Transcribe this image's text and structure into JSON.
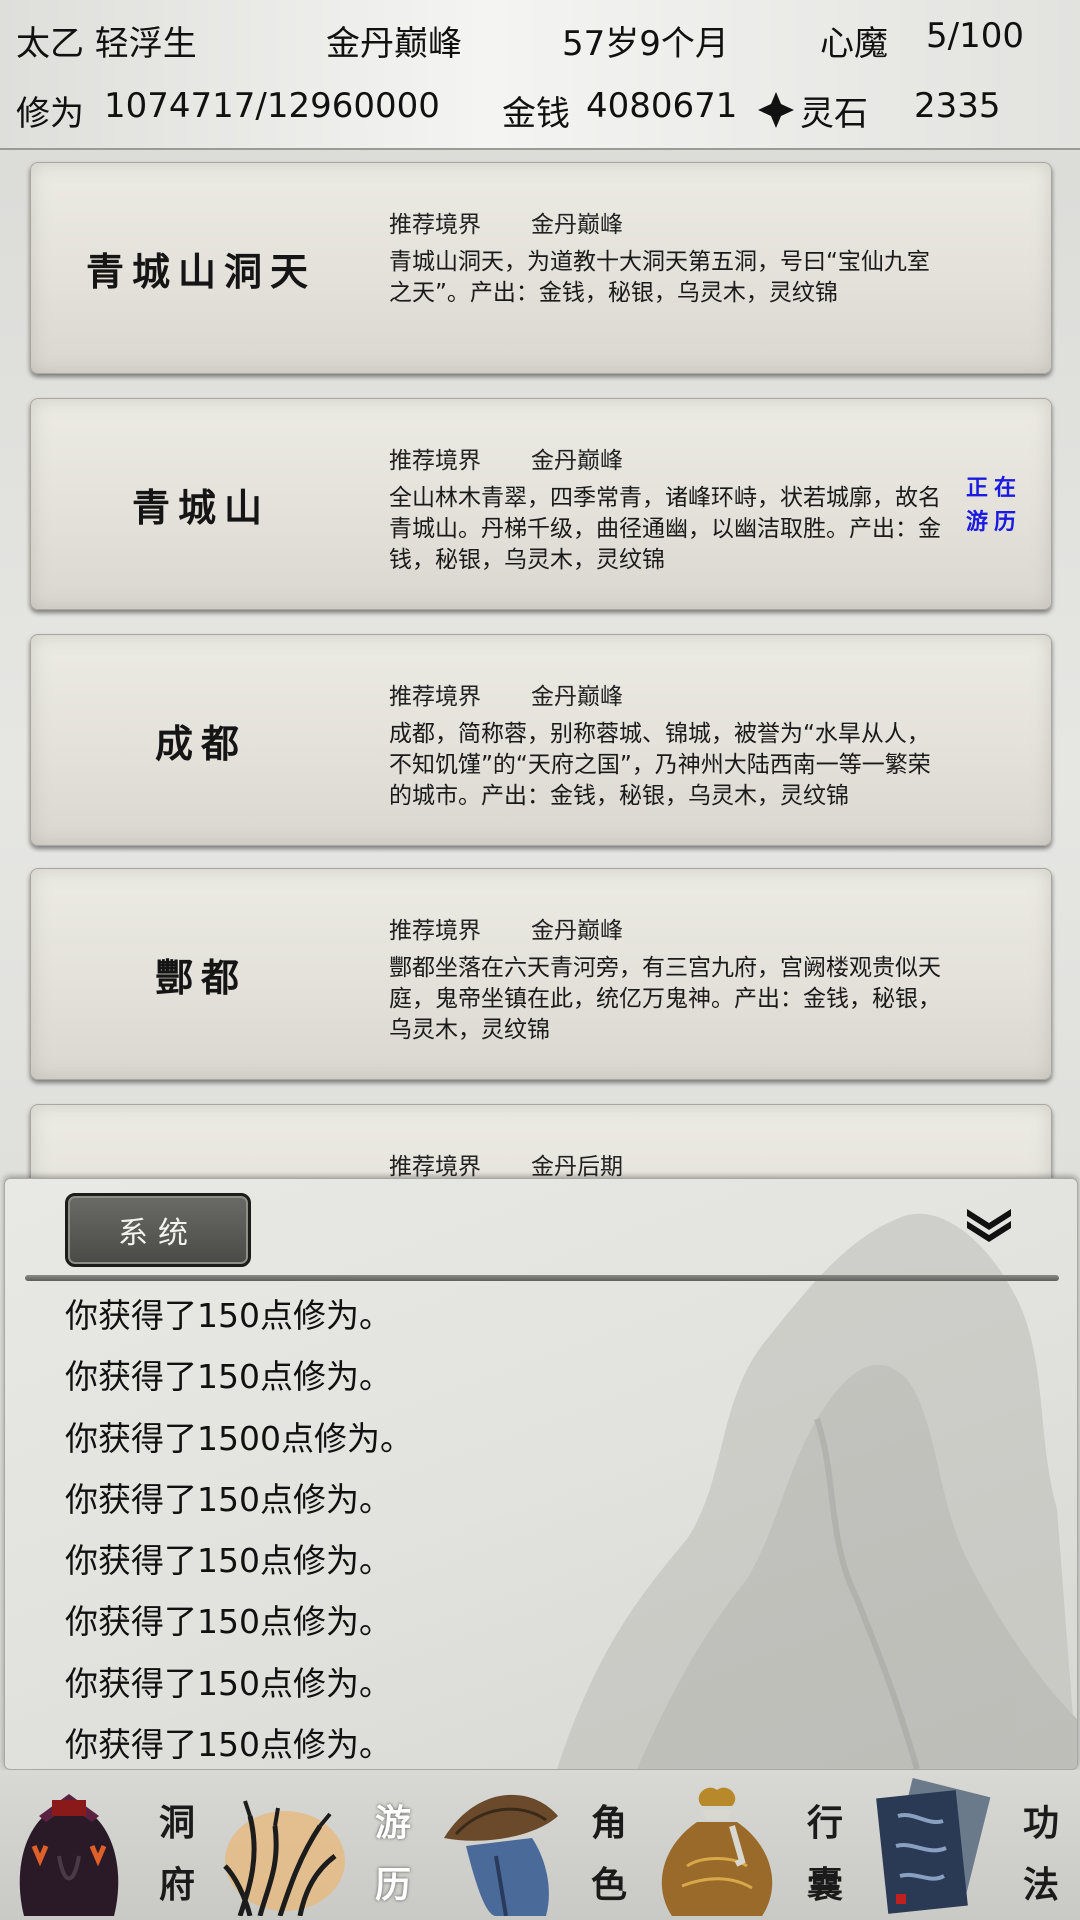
{
  "header": {
    "name": "太乙 轻浮生",
    "realm": "金丹巅峰",
    "age": "57岁9个月",
    "heart_demon_label": "心魔",
    "heart_demon_value": "5/100",
    "cultivation_label": "修为",
    "cultivation_value": "1074717/12960000",
    "money_label": "金钱",
    "money_value": "4080671",
    "spirit_stone_label": "灵石",
    "spirit_stone_value": "2335",
    "spirit_stone_icon": "spirit-stone-icon"
  },
  "locations": [
    {
      "name": "青城山洞天",
      "rec_label": "推荐境界",
      "rec_value": "金丹巅峰",
      "desc": "青城山洞天，为道教十大洞天第五洞，号曰“宝仙九室之天”。产出：金钱，秘银，乌灵木，灵纹锦"
    },
    {
      "name": "青城山",
      "rec_label": "推荐境界",
      "rec_value": "金丹巅峰",
      "desc": "全山林木青翠，四季常青，诸峰环峙，状若城廓，故名青城山。丹梯千级，曲径通幽，以幽洁取胜。产出：金钱，秘银，乌灵木，灵纹锦",
      "status": "正在游历"
    },
    {
      "name": "成都",
      "rec_label": "推荐境界",
      "rec_value": "金丹巅峰",
      "desc": "成都，简称蓉，别称蓉城、锦城，被誉为“水旱从人，不知饥馑”的“天府之国”，乃神州大陆西南一等一繁荣的城市。产出：金钱，秘银，乌灵木，灵纹锦"
    },
    {
      "name": "酆都",
      "rec_label": "推荐境界",
      "rec_value": "金丹巅峰",
      "desc": "酆都坐落在六天青河旁，有三宫九府，宫阙楼观贵似天庭，鬼帝坐镇在此，统亿万鬼神。产出：金钱，秘银，乌灵木，灵纹锦"
    },
    {
      "name": "",
      "rec_label": "推荐境界",
      "rec_value": "金丹后期",
      "desc": ""
    }
  ],
  "log_panel": {
    "tab_label": "系统",
    "collapse_icon": "double-chevron-down-icon",
    "lines": [
      "你获得了150点修为。",
      "你获得了150点修为。",
      "你获得了1500点修为。",
      "你获得了150点修为。",
      "你获得了150点修为。",
      "你获得了150点修为。",
      "你获得了150点修为。",
      "你获得了150点修为。"
    ]
  },
  "nav": [
    {
      "label": "洞府",
      "icon": "cave-residence-icon",
      "active": false
    },
    {
      "label": "游历",
      "icon": "travel-reeds-icon",
      "active": true
    },
    {
      "label": "角色",
      "icon": "character-straw-hat-icon",
      "active": false
    },
    {
      "label": "行囊",
      "icon": "bag-icon",
      "active": false
    },
    {
      "label": "功法",
      "icon": "manual-book-icon",
      "active": false
    }
  ]
}
